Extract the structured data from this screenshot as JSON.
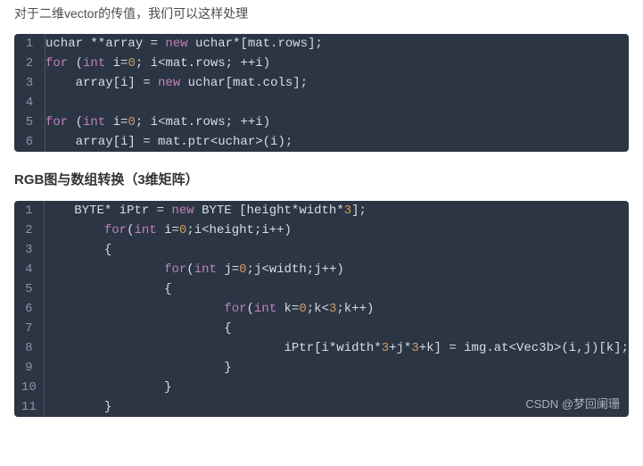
{
  "intro_text": "对于二维vector的传值，我们可以这样处理",
  "code1": {
    "line_numbers": [
      "1",
      "2",
      "3",
      "4",
      "5",
      "6"
    ],
    "lines": [
      {
        "tokens": [
          {
            "c": "ident",
            "t": "uchar **array = "
          },
          {
            "c": "kw",
            "t": "new"
          },
          {
            "c": "ident",
            "t": " uchar*[mat.rows];"
          }
        ]
      },
      {
        "tokens": [
          {
            "c": "kw",
            "t": "for"
          },
          {
            "c": "ident",
            "t": " ("
          },
          {
            "c": "type",
            "t": "int"
          },
          {
            "c": "ident",
            "t": " i="
          },
          {
            "c": "num",
            "t": "0"
          },
          {
            "c": "ident",
            "t": "; i<mat.rows; ++i)"
          }
        ]
      },
      {
        "tokens": [
          {
            "c": "ident",
            "t": "    array[i] = "
          },
          {
            "c": "kw",
            "t": "new"
          },
          {
            "c": "ident",
            "t": " uchar[mat.cols];"
          }
        ]
      },
      {
        "tokens": [
          {
            "c": "ident",
            "t": ""
          }
        ]
      },
      {
        "tokens": [
          {
            "c": "kw",
            "t": "for"
          },
          {
            "c": "ident",
            "t": " ("
          },
          {
            "c": "type",
            "t": "int"
          },
          {
            "c": "ident",
            "t": " i="
          },
          {
            "c": "num",
            "t": "0"
          },
          {
            "c": "ident",
            "t": "; i<mat.rows; ++i)"
          }
        ]
      },
      {
        "tokens": [
          {
            "c": "ident",
            "t": "    array[i] = mat.ptr<uchar>(i);"
          }
        ]
      }
    ]
  },
  "heading2": "RGB图与数组转换（3维矩阵）",
  "code2": {
    "line_numbers": [
      "1",
      "2",
      "3",
      "4",
      "5",
      "6",
      "7",
      "8",
      "9",
      "10",
      "11"
    ],
    "lines": [
      {
        "tokens": [
          {
            "c": "ident",
            "t": "    BYTE* iPtr = "
          },
          {
            "c": "kw",
            "t": "new"
          },
          {
            "c": "ident",
            "t": " BYTE [height*width*"
          },
          {
            "c": "num",
            "t": "3"
          },
          {
            "c": "ident",
            "t": "];"
          }
        ]
      },
      {
        "tokens": [
          {
            "c": "ident",
            "t": "        "
          },
          {
            "c": "kw",
            "t": "for"
          },
          {
            "c": "ident",
            "t": "("
          },
          {
            "c": "type",
            "t": "int"
          },
          {
            "c": "ident",
            "t": " i="
          },
          {
            "c": "num",
            "t": "0"
          },
          {
            "c": "ident",
            "t": ";i<height;i++)"
          }
        ]
      },
      {
        "tokens": [
          {
            "c": "ident",
            "t": "        {"
          }
        ]
      },
      {
        "tokens": [
          {
            "c": "ident",
            "t": "                "
          },
          {
            "c": "kw",
            "t": "for"
          },
          {
            "c": "ident",
            "t": "("
          },
          {
            "c": "type",
            "t": "int"
          },
          {
            "c": "ident",
            "t": " j="
          },
          {
            "c": "num",
            "t": "0"
          },
          {
            "c": "ident",
            "t": ";j<width;j++)"
          }
        ]
      },
      {
        "tokens": [
          {
            "c": "ident",
            "t": "                {"
          }
        ]
      },
      {
        "tokens": [
          {
            "c": "ident",
            "t": "                        "
          },
          {
            "c": "kw",
            "t": "for"
          },
          {
            "c": "ident",
            "t": "("
          },
          {
            "c": "type",
            "t": "int"
          },
          {
            "c": "ident",
            "t": " k="
          },
          {
            "c": "num",
            "t": "0"
          },
          {
            "c": "ident",
            "t": ";k<"
          },
          {
            "c": "num",
            "t": "3"
          },
          {
            "c": "ident",
            "t": ";k++)"
          }
        ]
      },
      {
        "tokens": [
          {
            "c": "ident",
            "t": "                        {"
          }
        ]
      },
      {
        "tokens": [
          {
            "c": "ident",
            "t": "                                iPtr[i*width*"
          },
          {
            "c": "num",
            "t": "3"
          },
          {
            "c": "ident",
            "t": "+j*"
          },
          {
            "c": "num",
            "t": "3"
          },
          {
            "c": "ident",
            "t": "+k] = img.at<Vec3b>(i,j)[k];"
          }
        ]
      },
      {
        "tokens": [
          {
            "c": "ident",
            "t": "                        }"
          }
        ]
      },
      {
        "tokens": [
          {
            "c": "ident",
            "t": "                }"
          }
        ]
      },
      {
        "tokens": [
          {
            "c": "ident",
            "t": "        }"
          }
        ]
      }
    ]
  },
  "watermark": "CSDN @梦回阑珊"
}
